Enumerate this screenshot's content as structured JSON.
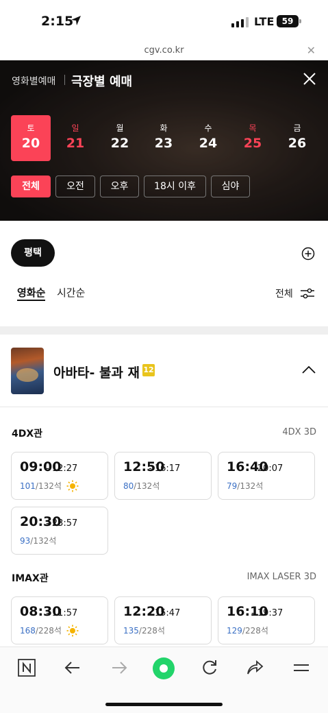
{
  "status": {
    "time": "2:15",
    "network": "LTE",
    "battery": "59"
  },
  "browser": {
    "url": "cgv.co.kr"
  },
  "header": {
    "sub_title": "영화별예매",
    "title": "극장별 예매"
  },
  "dates": [
    {
      "dow": "토",
      "day": "20",
      "selected": true
    },
    {
      "dow": "일",
      "day": "21",
      "holiday": true
    },
    {
      "dow": "월",
      "day": "22"
    },
    {
      "dow": "화",
      "day": "23"
    },
    {
      "dow": "수",
      "day": "24"
    },
    {
      "dow": "목",
      "day": "25",
      "holiday": true
    },
    {
      "dow": "금",
      "day": "26"
    }
  ],
  "time_filters": [
    "전체",
    "오전",
    "오후",
    "18시 이후",
    "심야"
  ],
  "theater": {
    "name": "평택"
  },
  "sort_tabs": [
    "영화순",
    "시간순"
  ],
  "filter_label": "전체",
  "movie": {
    "title": "아바타- 불과 재",
    "age_rating": "12"
  },
  "halls": [
    {
      "name": "4DX관",
      "format": "4DX 3D",
      "showtimes": [
        {
          "start": "09:00",
          "end": "- 12:27",
          "available": "101",
          "total": "/132석",
          "morning": true
        },
        {
          "start": "12:50",
          "end": "- 16:17",
          "available": "80",
          "total": "/132석"
        },
        {
          "start": "16:40",
          "end": "- 20:07",
          "available": "79",
          "total": "/132석"
        },
        {
          "start": "20:30",
          "end": "- 23:57",
          "available": "93",
          "total": "/132석"
        }
      ]
    },
    {
      "name": "IMAX관",
      "format": "IMAX LASER 3D",
      "showtimes": [
        {
          "start": "08:30",
          "end": "- 11:57",
          "available": "168",
          "total": "/228석",
          "morning": true
        },
        {
          "start": "12:20",
          "end": "- 15:47",
          "available": "135",
          "total": "/228석"
        },
        {
          "start": "16:10",
          "end": "- 19:37",
          "available": "129",
          "total": "/228석"
        }
      ]
    }
  ],
  "colors": {
    "accent": "#fb4357",
    "seat_available": "#3a6fc4",
    "age_12": "#e9c41c",
    "browser_home": "#22d46a"
  },
  "icons": [
    "location-arrow-icon",
    "close-icon",
    "plus-circle-icon",
    "filter-sliders-icon",
    "chevron-up-icon",
    "sun-icon",
    "naver-icon",
    "back-arrow-icon",
    "forward-arrow-icon",
    "home-dot-icon",
    "refresh-icon",
    "share-icon",
    "menu-icon"
  ]
}
